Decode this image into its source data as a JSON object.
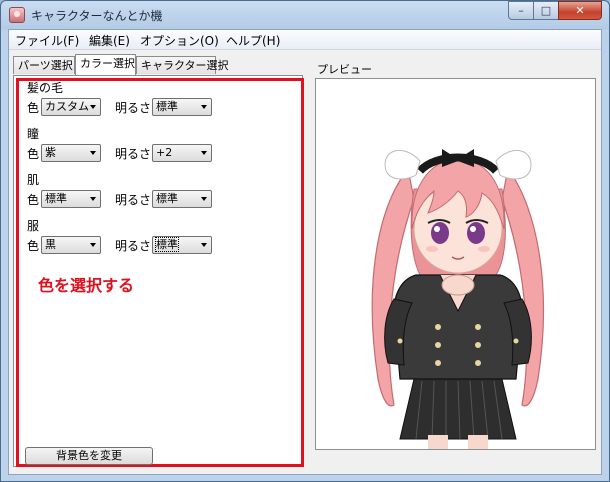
{
  "window": {
    "title": "キャラクターなんとか機",
    "min_label": "–",
    "max_label": "□",
    "close_label": "✕"
  },
  "menu": [
    {
      "label": "ファイル(F)"
    },
    {
      "label": "編集(E)"
    },
    {
      "label": "オプション(O)"
    },
    {
      "label": "ヘルプ(H)"
    }
  ],
  "tabs": [
    {
      "label": "パーツ選択",
      "active": false
    },
    {
      "label": "カラー選択",
      "active": true
    },
    {
      "label": "キャラクター選択",
      "active": false
    }
  ],
  "sections": [
    {
      "title": "髪の毛",
      "color_label": "色",
      "color_value": "カスタム",
      "brightness_label": "明るさ",
      "brightness_value": "標準"
    },
    {
      "title": "瞳",
      "color_label": "色",
      "color_value": "紫",
      "brightness_label": "明るさ",
      "brightness_value": "+2"
    },
    {
      "title": "肌",
      "color_label": "色",
      "color_value": "標準",
      "brightness_label": "明るさ",
      "brightness_value": "標準"
    },
    {
      "title": "服",
      "color_label": "色",
      "color_value": "黒",
      "brightness_label": "明るさ",
      "brightness_value": "標準"
    }
  ],
  "annotation": "色を選択する",
  "background_button": "背景色を変更",
  "preview_label": "プレビュー",
  "colors": {
    "highlight": "#e0101e",
    "hair": "#f2a4a6",
    "uniform": "#3a3a3a",
    "ribbon": "#ffffff"
  }
}
